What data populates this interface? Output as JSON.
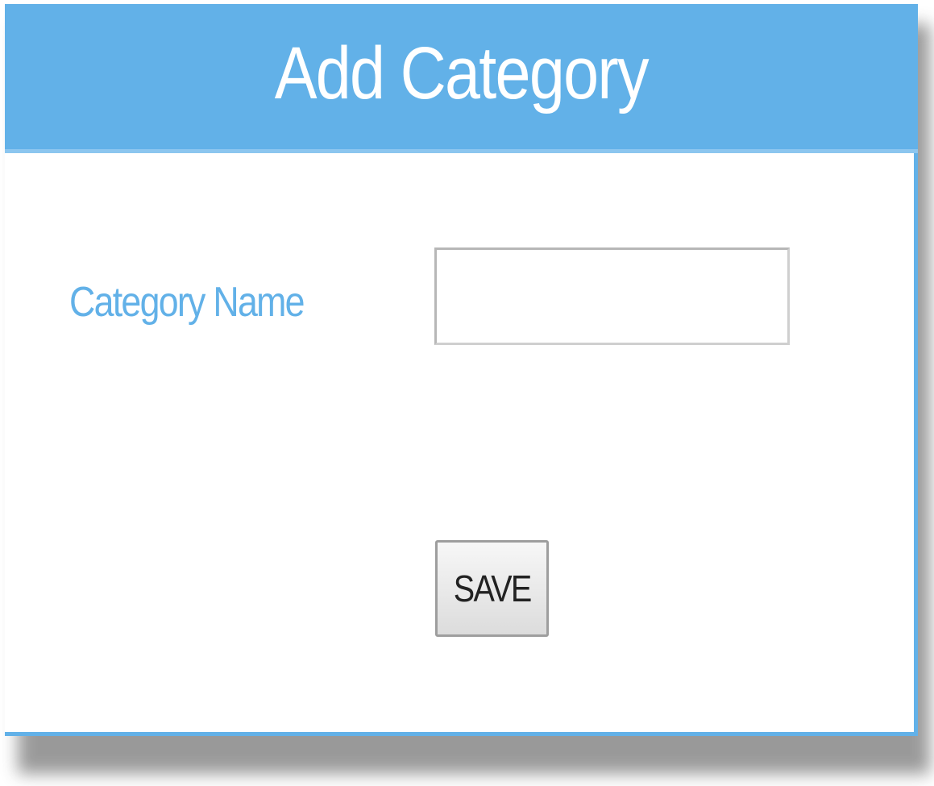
{
  "form": {
    "title": "Add Category",
    "category_name_label": "Category Name",
    "category_name_value": "",
    "category_name_placeholder": "",
    "save_label": "SAVE"
  },
  "colors": {
    "accent": "#62b1e8",
    "header_text": "#ffffff",
    "label_text": "#62b1e8"
  }
}
